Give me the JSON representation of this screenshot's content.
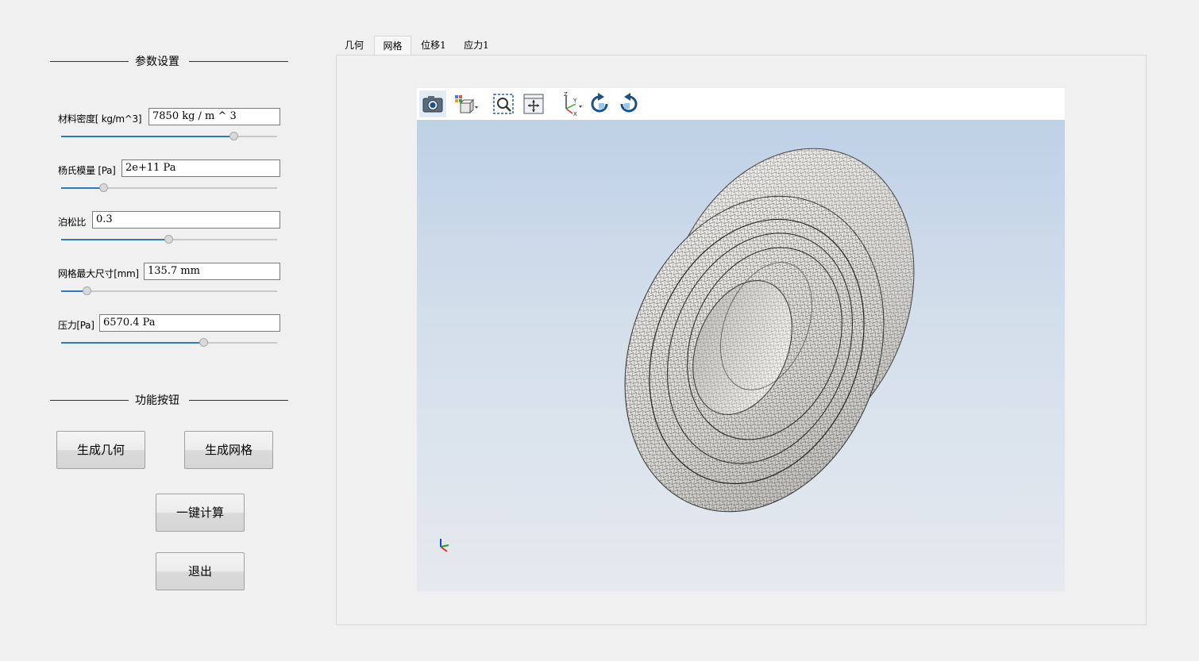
{
  "left_panel": {
    "params_group_title": "参数设置",
    "params": [
      {
        "label": "材料密度[ kg/m^3]",
        "value": "7850 kg / m ^ 3",
        "slider_fraction": 0.8
      },
      {
        "label": "杨氏模量 [Pa]",
        "value": "2e+11 Pa",
        "slider_fraction": 0.2
      },
      {
        "label": "泊松比",
        "value": "0.3",
        "slider_fraction": 0.5
      },
      {
        "label": "网格最大尺寸[mm]",
        "value": "135.7 mm",
        "slider_fraction": 0.12
      },
      {
        "label": "压力[Pa]",
        "value": "6570.4 Pa",
        "slider_fraction": 0.66
      }
    ],
    "actions_group_title": "功能按钮",
    "buttons": {
      "generate_geometry": "生成几何",
      "generate_mesh": "生成网格",
      "one_click_compute": "一键计算",
      "exit": "退出"
    }
  },
  "tabs": [
    {
      "label": "几何",
      "active": false
    },
    {
      "label": "网格",
      "active": true
    },
    {
      "label": "位移1",
      "active": false
    },
    {
      "label": "应力1",
      "active": false
    }
  ],
  "viewer": {
    "toolbar_icons": [
      "camera-icon",
      "display-mode-icon",
      "zoom-box-icon",
      "fit-all-icon",
      "axes-view-icon",
      "rotate-cw-icon",
      "rotate-ccw-icon"
    ],
    "colors": {
      "background_top": "#bfd1e6",
      "background_bottom": "#e6e9ef",
      "slider_fill": "#2a7bc2",
      "axis_x": "#e03030",
      "axis_y": "#20a020",
      "axis_z": "#2040e0"
    }
  }
}
